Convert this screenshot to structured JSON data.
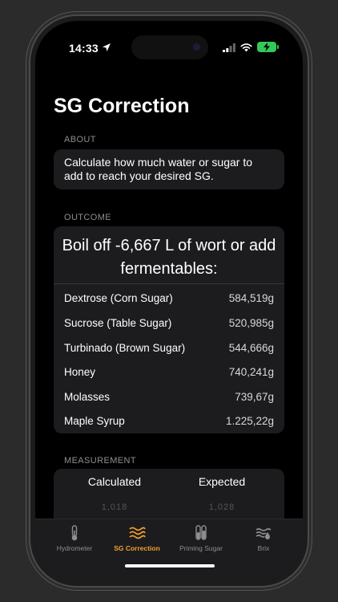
{
  "status": {
    "time": "14:33"
  },
  "page": {
    "title": "SG Correction"
  },
  "about": {
    "label": "ABOUT",
    "text": "Calculate how much water or sugar to add to reach your desired SG."
  },
  "outcome": {
    "label": "OUTCOME",
    "headline": "Boil off -6,667 L of wort or add fermentables:",
    "rows": [
      {
        "name": "Dextrose (Corn Sugar)",
        "value": "584,519g"
      },
      {
        "name": "Sucrose (Table Sugar)",
        "value": "520,985g"
      },
      {
        "name": "Turbinado (Brown Sugar)",
        "value": "544,666g"
      },
      {
        "name": "Honey",
        "value": "740,241g"
      },
      {
        "name": "Molasses",
        "value": "739,67g"
      },
      {
        "name": "Maple Syrup",
        "value": "1.225,22g"
      }
    ]
  },
  "measurement": {
    "label": "MEASUREMENT",
    "calculated_label": "Calculated",
    "expected_label": "Expected",
    "calculated_value": "1,018",
    "expected_value": "1,028"
  },
  "tabs": [
    {
      "label": "Hydrometer",
      "icon": "thermometer-icon",
      "active": false
    },
    {
      "label": "SG Correction",
      "icon": "waves-icon",
      "active": true
    },
    {
      "label": "Priming Sugar",
      "icon": "test-tubes-icon",
      "active": false
    },
    {
      "label": "Brix",
      "icon": "brix-icon",
      "active": false
    }
  ],
  "colors": {
    "accent": "#f0a030",
    "card": "#1c1c1e",
    "background": "#000000",
    "battery": "#34c759"
  }
}
